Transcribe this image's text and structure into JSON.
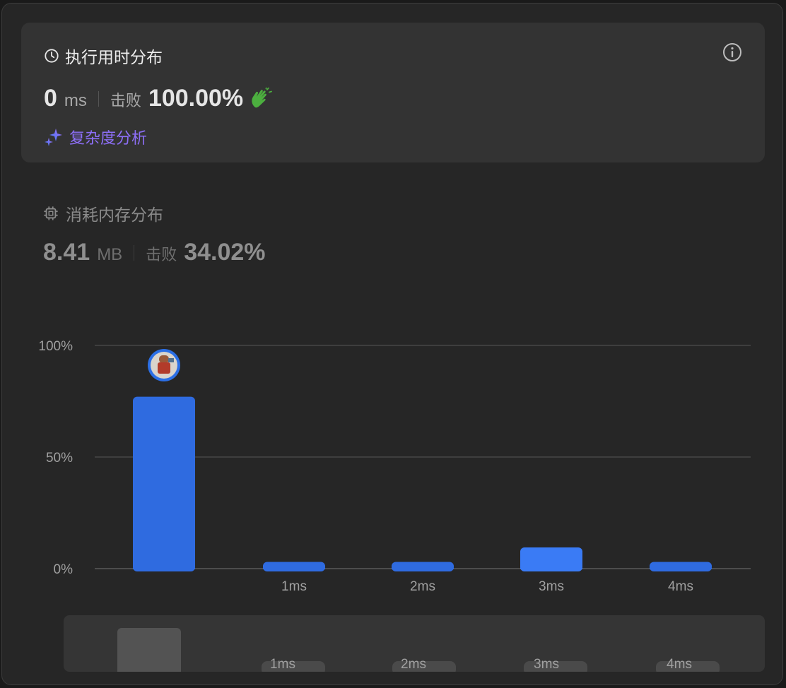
{
  "runtime": {
    "title": "执行用时分布",
    "value": "0",
    "unit": "ms",
    "beats_label": "击败",
    "beats_pct": "100.00%",
    "complexity_label": "复杂度分析"
  },
  "memory": {
    "title": "消耗内存分布",
    "value": "8.41",
    "unit": "MB",
    "beats_label": "击败",
    "beats_pct": "34.02%"
  },
  "colors": {
    "accent": "#2f6be0",
    "accent_light": "#3a7bf5",
    "purple": "#8d6ff7",
    "clap": "#4caf3f"
  },
  "icons": [
    "clock-icon",
    "info-icon",
    "clap-icon",
    "sparkle-icon",
    "chip-icon",
    "avatar"
  ],
  "chart_data": {
    "type": "bar",
    "categories": [
      "0ms",
      "1ms",
      "2ms",
      "3ms",
      "4ms"
    ],
    "x_tick_labels": [
      "",
      "1ms",
      "2ms",
      "3ms",
      "4ms"
    ],
    "values": [
      77,
      3,
      3,
      9.5,
      3
    ],
    "highlighted_index": 0,
    "ylim": [
      0,
      100
    ],
    "y_ticks": [
      "0%",
      "50%",
      "100%"
    ],
    "grid": true,
    "mini_overview": {
      "tick_labels": [
        "",
        "1ms",
        "2ms",
        "3ms",
        "4ms"
      ]
    }
  }
}
